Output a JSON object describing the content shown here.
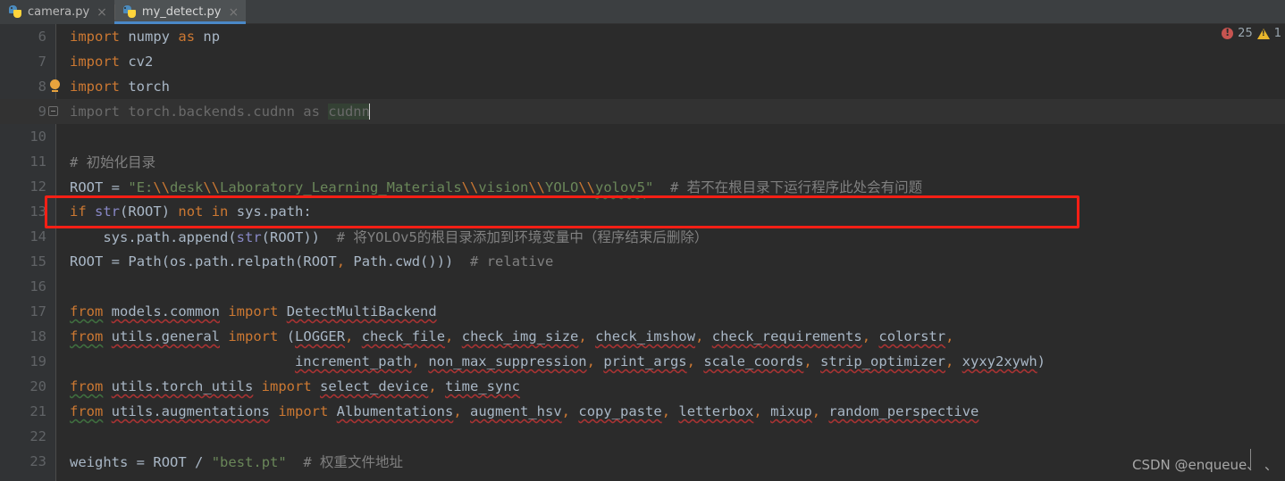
{
  "window": {
    "app": "PyCharm Code Editor",
    "theme_background": "#2b2b2b",
    "gutter_background": "#313335"
  },
  "tabs": [
    {
      "label": "camera.py",
      "icon": "python-file-icon",
      "close": "×",
      "active": false
    },
    {
      "label": "my_detect.py",
      "icon": "python-file-icon",
      "close": "×",
      "active": true
    }
  ],
  "inspection": {
    "error_icon": "error-circle-icon",
    "error_count": "25",
    "warning_icon": "warning-triangle-icon",
    "warning_count": "1",
    "accent_error": "#c75450",
    "accent_warning": "#e8b62c"
  },
  "annotation": {
    "type": "red-rectangle-highlight",
    "color": "#f51f15",
    "targets_line": "12"
  },
  "watermark": {
    "text": "CSDN @enqueue、 、"
  },
  "editor": {
    "first_line": "6",
    "lines": [
      {
        "no": "6",
        "text": "import numpy as np"
      },
      {
        "no": "7",
        "text": "import cv2"
      },
      {
        "no": "8",
        "text": "import torch"
      },
      {
        "no": "9",
        "text": "import torch.backends.cudnn as cudnn"
      },
      {
        "no": "10",
        "text": ""
      },
      {
        "no": "11",
        "text": "# 初始化目录"
      },
      {
        "no": "12",
        "text": "ROOT = \"E:\\\\desk\\\\Laboratory_Learning_Materials\\\\vision\\\\YOLO\\\\yolov5\"  # 若不在根目录下运行程序此处会有问题"
      },
      {
        "no": "13",
        "text": "if str(ROOT) not in sys.path:"
      },
      {
        "no": "14",
        "text": "    sys.path.append(str(ROOT))  # 将YOLOv5的根目录添加到环境变量中（程序结束后删除）"
      },
      {
        "no": "15",
        "text": "ROOT = Path(os.path.relpath(ROOT, Path.cwd()))  # relative"
      },
      {
        "no": "16",
        "text": ""
      },
      {
        "no": "17",
        "text": "from models.common import DetectMultiBackend"
      },
      {
        "no": "18",
        "text": "from utils.general import (LOGGER, check_file, check_img_size, check_imshow, check_requirements, colorstr,"
      },
      {
        "no": "19",
        "text": "                           increment_path, non_max_suppression, print_args, scale_coords, strip_optimizer, xyxy2xywh)"
      },
      {
        "no": "20",
        "text": "from utils.torch_utils import select_device, time_sync"
      },
      {
        "no": "21",
        "text": "from utils.augmentations import Albumentations, augment_hsv, copy_paste, letterbox, mixup, random_perspective"
      },
      {
        "no": "22",
        "text": ""
      },
      {
        "no": "23",
        "text": "weights = ROOT / \"best.pt\"  # 权重文件地址"
      }
    ],
    "tokens": {
      "l6": {
        "kw": "import",
        "mod": "numpy",
        "as": "as",
        "alias": "np"
      },
      "l7": {
        "kw": "import",
        "mod": "cv2"
      },
      "l8": {
        "kw": "import",
        "mod": "torch"
      },
      "l9": {
        "full": "import torch.backends.cudnn as cudnn",
        "state": "grayed-unused",
        "caret_after": "cudnn"
      },
      "l11": {
        "comment": "# 初始化目录"
      },
      "l12": {
        "var": "ROOT",
        "eq": "=",
        "string_open": "\"E:",
        "esc": "\\\\",
        "p1": "desk",
        "p2": "Laboratory_Learning_Materials",
        "p3": "vision",
        "p4": "YOLO",
        "p5": "yolov5",
        "string_close": "\"",
        "comment": "# 若不在根目录下运行程序此处会有问题"
      },
      "l13": {
        "kw_if": "if",
        "fn": "str",
        "arg": "ROOT",
        "kw_not": "not",
        "kw_in": "in",
        "obj": "sys.path"
      },
      "l14": {
        "call": "sys.path.append(",
        "fn": "str",
        "arg": "ROOT",
        "comment": "# 将YOLOv5的根目录添加到环境变量中（程序结束后删除）"
      },
      "l15": {
        "lhs": "ROOT = Path(os.path.relpath(ROOT",
        "rhs": "Path.cwd()))",
        "comment": "# relative"
      },
      "l17": {
        "kw_from": "from",
        "mod": "models.common",
        "kw_import": "import",
        "name": "DetectMultiBackend"
      },
      "l18": {
        "kw_from": "from",
        "mod": "utils.general",
        "kw_import": "import",
        "names": [
          "LOGGER",
          "check_file",
          "check_img_size",
          "check_imshow",
          "check_requirements",
          "colorstr"
        ]
      },
      "l19": {
        "names": [
          "increment_path",
          "non_max_suppression",
          "print_args",
          "scale_coords",
          "strip_optimizer",
          "xyxy2xywh"
        ]
      },
      "l20": {
        "kw_from": "from",
        "mod": "utils.torch_utils",
        "kw_import": "import",
        "names": [
          "select_device",
          "time_sync"
        ]
      },
      "l21": {
        "kw_from": "from",
        "mod": "utils.augmentations",
        "kw_import": "import",
        "names": [
          "Albumentations",
          "augment_hsv",
          "copy_paste",
          "letterbox",
          "mixup",
          "random_perspective"
        ]
      },
      "l23": {
        "var": "weights",
        "eq": "=",
        "root": "ROOT",
        "slash": "/",
        "str": "\"best.pt\"",
        "comment": "# 权重文件地址"
      }
    },
    "markers": {
      "line8_gutter": "lightbulb-intention-icon",
      "line9_gutter": "code-fold-collapse-icon"
    },
    "colors": {
      "keyword": "#cc7832",
      "string": "#6a8759",
      "comment": "#808080",
      "identifier": "#a9b7c6",
      "builtin": "#8888c6",
      "line_number": "#606366",
      "current_line_bg": "#323232",
      "error_squiggle": "#a33333",
      "typo_squiggle": "#3f6f3f"
    }
  }
}
